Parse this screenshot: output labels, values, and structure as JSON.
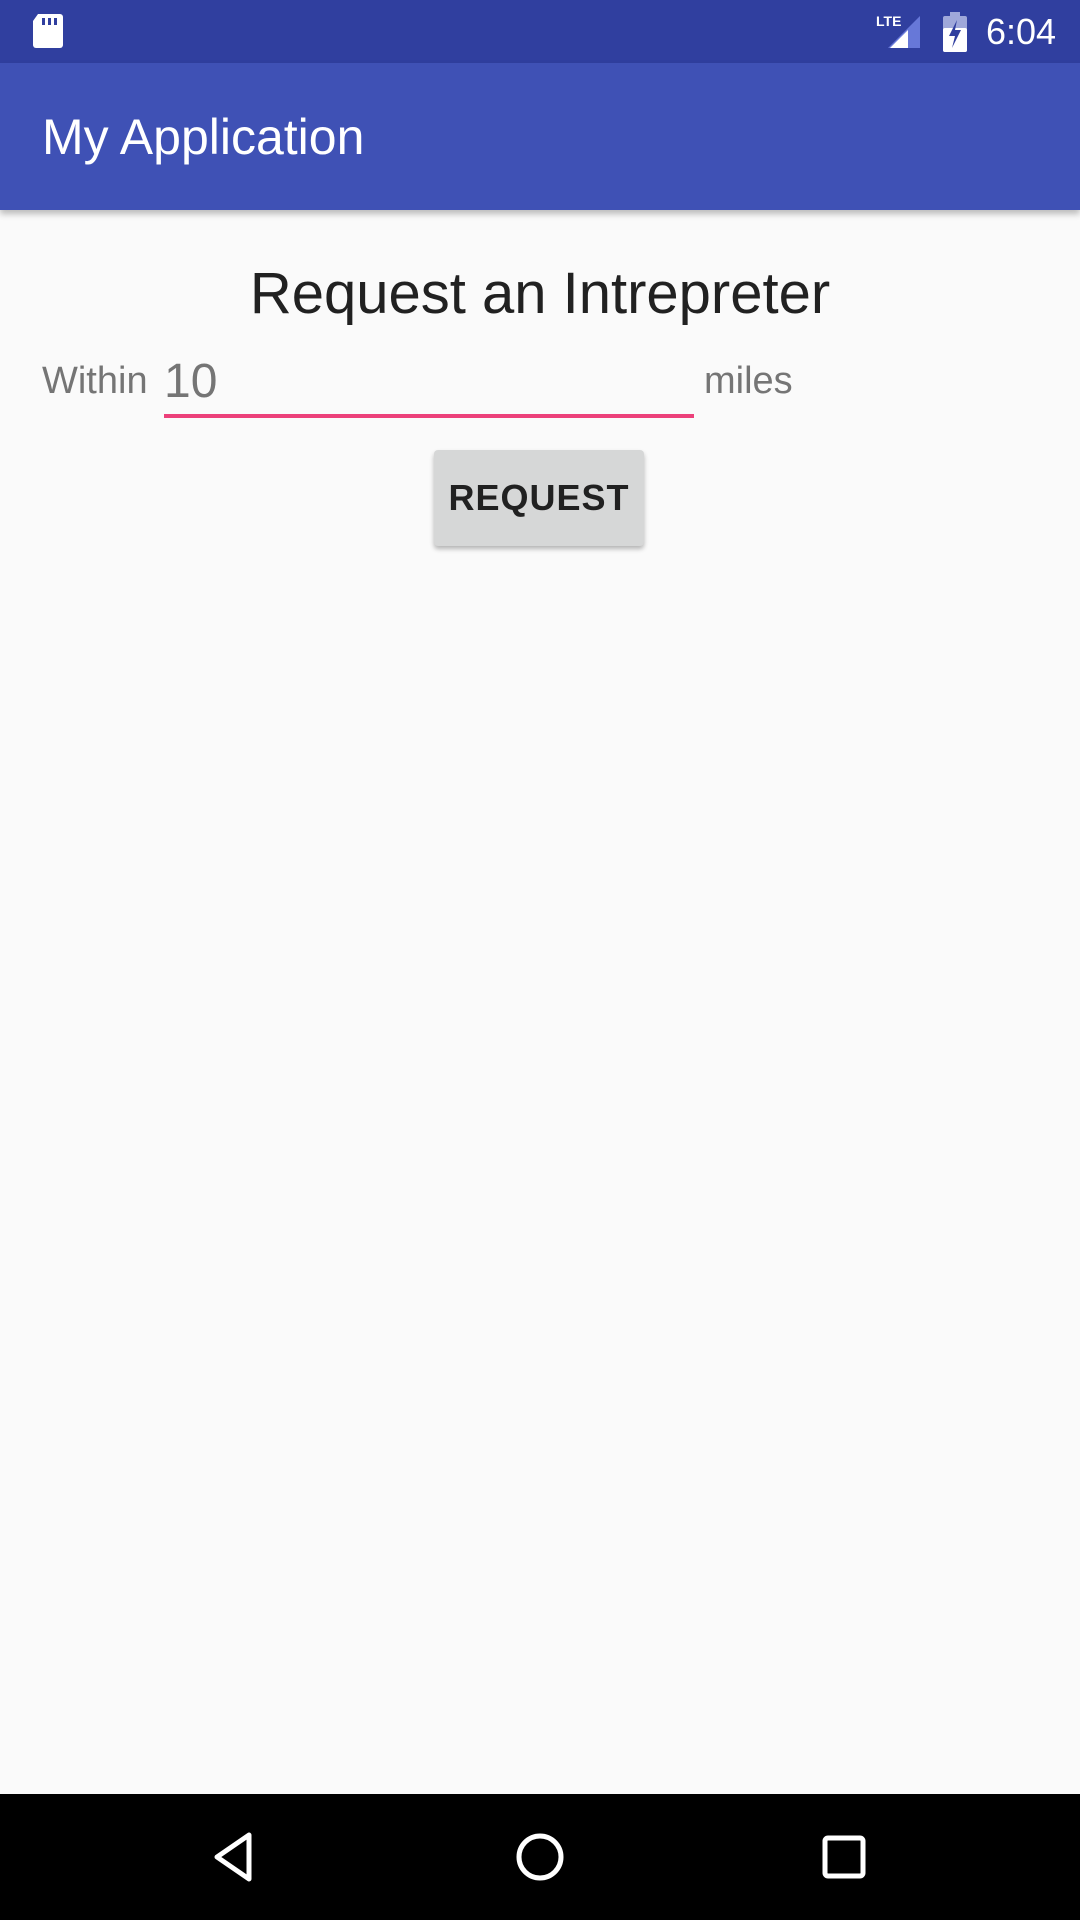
{
  "status_bar": {
    "time": "6:04",
    "network_label": "LTE",
    "icons": [
      "sd-card-icon",
      "lte-signal-icon",
      "battery-charging-icon"
    ]
  },
  "app_bar": {
    "title": "My Application"
  },
  "main": {
    "heading": "Request an Intrepreter",
    "within_label": "Within",
    "distance_value": "10",
    "unit_label": "miles",
    "request_button_label": "REQUEST"
  },
  "nav_bar": {
    "icons": [
      "back-icon",
      "home-icon",
      "recents-icon"
    ]
  },
  "colors": {
    "status_bar": "#303f9f",
    "app_bar": "#3f51b5",
    "accent": "#ec407a",
    "background": "#fafafa",
    "button": "#d6d7d7"
  }
}
